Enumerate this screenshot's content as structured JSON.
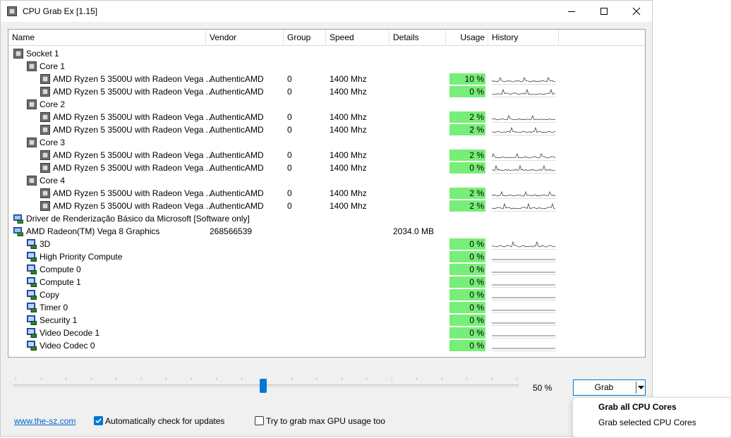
{
  "window": {
    "title": "CPU Grab Ex [1.15]",
    "controls": [
      "minimize",
      "maximize",
      "close"
    ]
  },
  "columns": [
    "Name",
    "Vendor",
    "Group",
    "Speed",
    "Details",
    "Usage",
    "History"
  ],
  "rows": [
    {
      "level": 0,
      "icon": "chip-icon",
      "name": "Socket 1",
      "vendor": "",
      "group": "",
      "speed": "",
      "details": "",
      "usage": "",
      "history": false
    },
    {
      "level": 1,
      "icon": "chip-icon",
      "name": "Core 1",
      "vendor": "",
      "group": "",
      "speed": "",
      "details": "",
      "usage": "",
      "history": false
    },
    {
      "level": 2,
      "icon": "chip-icon",
      "name": "AMD Ryzen 5 3500U with Radeon Vega ...",
      "vendor": "AuthenticAMD",
      "group": "0",
      "speed": "1400 Mhz",
      "details": "",
      "usage": "10 %",
      "history": true
    },
    {
      "level": 2,
      "icon": "chip-icon",
      "name": "AMD Ryzen 5 3500U with Radeon Vega ...",
      "vendor": "AuthenticAMD",
      "group": "0",
      "speed": "1400 Mhz",
      "details": "",
      "usage": "0 %",
      "history": true
    },
    {
      "level": 1,
      "icon": "chip-icon",
      "name": "Core 2",
      "vendor": "",
      "group": "",
      "speed": "",
      "details": "",
      "usage": "",
      "history": false
    },
    {
      "level": 2,
      "icon": "chip-icon",
      "name": "AMD Ryzen 5 3500U with Radeon Vega ...",
      "vendor": "AuthenticAMD",
      "group": "0",
      "speed": "1400 Mhz",
      "details": "",
      "usage": "2 %",
      "history": true
    },
    {
      "level": 2,
      "icon": "chip-icon",
      "name": "AMD Ryzen 5 3500U with Radeon Vega ...",
      "vendor": "AuthenticAMD",
      "group": "0",
      "speed": "1400 Mhz",
      "details": "",
      "usage": "2 %",
      "history": true
    },
    {
      "level": 1,
      "icon": "chip-icon",
      "name": "Core 3",
      "vendor": "",
      "group": "",
      "speed": "",
      "details": "",
      "usage": "",
      "history": false
    },
    {
      "level": 2,
      "icon": "chip-icon",
      "name": "AMD Ryzen 5 3500U with Radeon Vega ...",
      "vendor": "AuthenticAMD",
      "group": "0",
      "speed": "1400 Mhz",
      "details": "",
      "usage": "2 %",
      "history": true
    },
    {
      "level": 2,
      "icon": "chip-icon",
      "name": "AMD Ryzen 5 3500U with Radeon Vega ...",
      "vendor": "AuthenticAMD",
      "group": "0",
      "speed": "1400 Mhz",
      "details": "",
      "usage": "0 %",
      "history": true
    },
    {
      "level": 1,
      "icon": "chip-icon",
      "name": "Core 4",
      "vendor": "",
      "group": "",
      "speed": "",
      "details": "",
      "usage": "",
      "history": false
    },
    {
      "level": 2,
      "icon": "chip-icon",
      "name": "AMD Ryzen 5 3500U with Radeon Vega ...",
      "vendor": "AuthenticAMD",
      "group": "0",
      "speed": "1400 Mhz",
      "details": "",
      "usage": "2 %",
      "history": true
    },
    {
      "level": 2,
      "icon": "chip-icon",
      "name": "AMD Ryzen 5 3500U with Radeon Vega ...",
      "vendor": "AuthenticAMD",
      "group": "0",
      "speed": "1400 Mhz",
      "details": "",
      "usage": "2 %",
      "history": true
    },
    {
      "level": 0,
      "icon": "monitor-icon",
      "name": "Driver de Renderização Básico da Microsoft [Software only]",
      "vendor": "",
      "group": "",
      "speed": "",
      "details": "",
      "usage": "",
      "history": false
    },
    {
      "level": 0,
      "icon": "monitor-icon",
      "name": "AMD Radeon(TM) Vega 8 Graphics",
      "vendor": "268566539",
      "group": "",
      "speed": "",
      "details": "2034.0 MB",
      "usage": "",
      "history": false
    },
    {
      "level": 1,
      "icon": "gpu-engine-icon",
      "name": "3D",
      "vendor": "",
      "group": "",
      "speed": "",
      "details": "",
      "usage": "0 %",
      "history": true
    },
    {
      "level": 1,
      "icon": "gpu-engine-icon",
      "name": "High Priority Compute",
      "vendor": "",
      "group": "",
      "speed": "",
      "details": "",
      "usage": "0 %",
      "history": true
    },
    {
      "level": 1,
      "icon": "gpu-engine-icon",
      "name": "Compute 0",
      "vendor": "",
      "group": "",
      "speed": "",
      "details": "",
      "usage": "0 %",
      "history": true
    },
    {
      "level": 1,
      "icon": "gpu-engine-icon",
      "name": "Compute 1",
      "vendor": "",
      "group": "",
      "speed": "",
      "details": "",
      "usage": "0 %",
      "history": true
    },
    {
      "level": 1,
      "icon": "gpu-engine-icon",
      "name": "Copy",
      "vendor": "",
      "group": "",
      "speed": "",
      "details": "",
      "usage": "0 %",
      "history": true
    },
    {
      "level": 1,
      "icon": "gpu-engine-icon",
      "name": "Timer 0",
      "vendor": "",
      "group": "",
      "speed": "",
      "details": "",
      "usage": "0 %",
      "history": true
    },
    {
      "level": 1,
      "icon": "gpu-engine-icon",
      "name": "Security 1",
      "vendor": "",
      "group": "",
      "speed": "",
      "details": "",
      "usage": "0 %",
      "history": true
    },
    {
      "level": 1,
      "icon": "gpu-engine-icon",
      "name": "Video Decode 1",
      "vendor": "",
      "group": "",
      "speed": "",
      "details": "",
      "usage": "0 %",
      "history": true
    },
    {
      "level": 1,
      "icon": "gpu-engine-icon",
      "name": "Video Codec 0",
      "vendor": "",
      "group": "",
      "speed": "",
      "details": "",
      "usage": "0 %",
      "history": true
    }
  ],
  "slider": {
    "value_percent": 50,
    "label": "50 %"
  },
  "grab_button": {
    "label": "Grab"
  },
  "dropdown_menu": [
    "Grab all CPU Cores",
    "Grab selected CPU Cores"
  ],
  "footer": {
    "link": "www.the-sz.com",
    "auto_update": {
      "label": "Automatically check for updates",
      "checked": true
    },
    "gpu_usage": {
      "label": "Try to grab max GPU usage too",
      "checked": false
    }
  },
  "colors": {
    "usage_bar": "#77ee77",
    "accent": "#0078d4",
    "link": "#0066cc"
  }
}
